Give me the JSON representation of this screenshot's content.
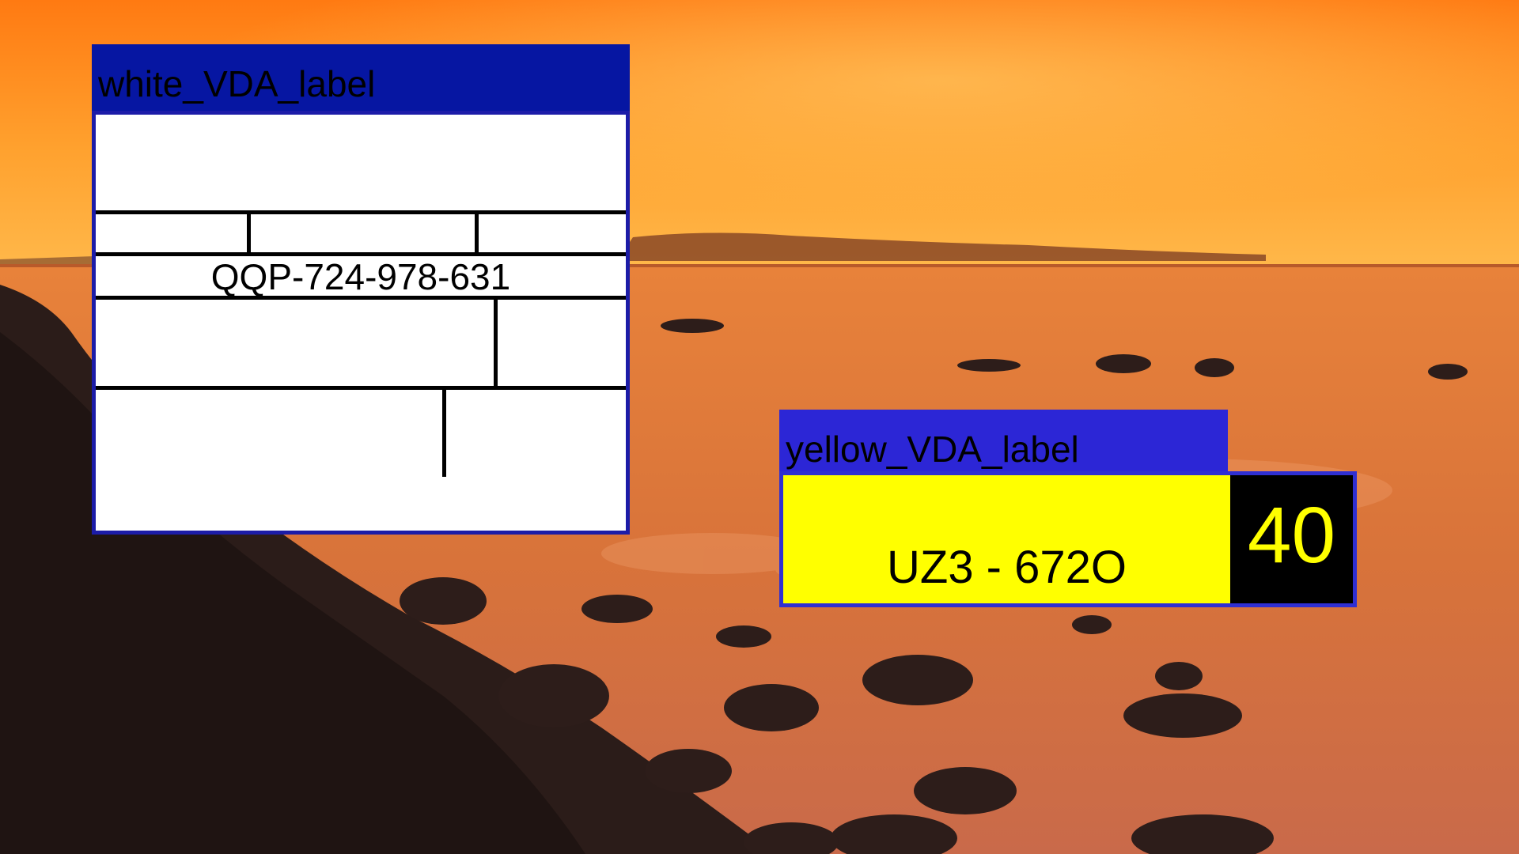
{
  "background": {
    "scene": "sunset-seascape-with-rocks",
    "colors": {
      "sky_top": "#ff8a1c",
      "sky_glow": "#ffb347",
      "sea": "#e0773a",
      "rocks": "#2a1a18"
    }
  },
  "white_label": {
    "title": "white_VDA_label",
    "code": "QQP-724-978-631",
    "colors": {
      "header": "#0616a2",
      "border": "#1c1ca8",
      "body": "#ffffff"
    }
  },
  "yellow_label": {
    "title": "yellow_VDA_label",
    "plate": "UZ3 - 672O",
    "number": "40",
    "colors": {
      "header": "#2c26d6",
      "border": "#2f2fd2",
      "plate_bg": "#ffff00",
      "number_bg": "#000000",
      "number_fg": "#ffff00"
    }
  }
}
